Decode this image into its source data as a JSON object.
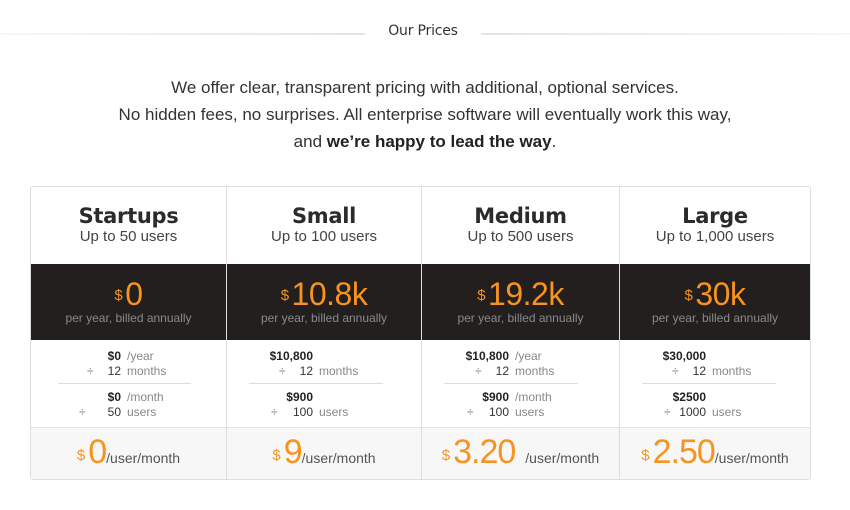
{
  "heading": {
    "title": "Our Prices"
  },
  "intro": {
    "line1": "We offer clear, transparent pricing with additional, optional services.",
    "line2": "No hidden fees, no surprises. All enterprise software will eventually work this way,",
    "line3_pre": "and ",
    "line3_bold": "we’re happy to lead the way",
    "line3_post": "."
  },
  "accent_color": "#f7931e",
  "plans": [
    {
      "name": "Startups",
      "users": "Up to 50 users",
      "currency": "$",
      "annual_price": "0",
      "billing": "per year, billed annually",
      "yearly_amount": "$0",
      "yearly_unit": "/year",
      "divide_symbol": "÷",
      "months": "12",
      "months_label": "months",
      "monthly_amount": "$0",
      "monthly_unit": "/month",
      "user_count": "50",
      "users_label": "users",
      "per_user_price": "0",
      "per_user_unit": "/user/month"
    },
    {
      "name": "Small",
      "users": "Up to 100 users",
      "currency": "$",
      "annual_price": "10.8k",
      "billing": "per year, billed annually",
      "yearly_amount": "$10,800",
      "yearly_unit": "",
      "divide_symbol": "÷",
      "months": "12",
      "months_label": "months",
      "monthly_amount": "$900",
      "monthly_unit": "",
      "user_count": "100",
      "users_label": "users",
      "per_user_price": "9",
      "per_user_unit": "/user/month"
    },
    {
      "name": "Medium",
      "users": "Up to 500 users",
      "currency": "$",
      "annual_price": "19.2k",
      "billing": "per year, billed annually",
      "yearly_amount": "$10,800",
      "yearly_unit": "/year",
      "divide_symbol": "÷",
      "months": "12",
      "months_label": "months",
      "monthly_amount": "$900",
      "monthly_unit": "/month",
      "user_count": "100",
      "users_label": "users",
      "per_user_price": "3.20",
      "per_user_unit": "/user/month"
    },
    {
      "name": "Large",
      "users": "Up to 1,000 users",
      "currency": "$",
      "annual_price": "30k",
      "billing": "per year, billed annually",
      "yearly_amount": "$30,000",
      "yearly_unit": "",
      "divide_symbol": "÷",
      "months": "12",
      "months_label": "months",
      "monthly_amount": "$2500",
      "monthly_unit": "",
      "user_count": "1000",
      "users_label": "users",
      "per_user_price": "2.50",
      "per_user_unit": "/user/month"
    }
  ]
}
